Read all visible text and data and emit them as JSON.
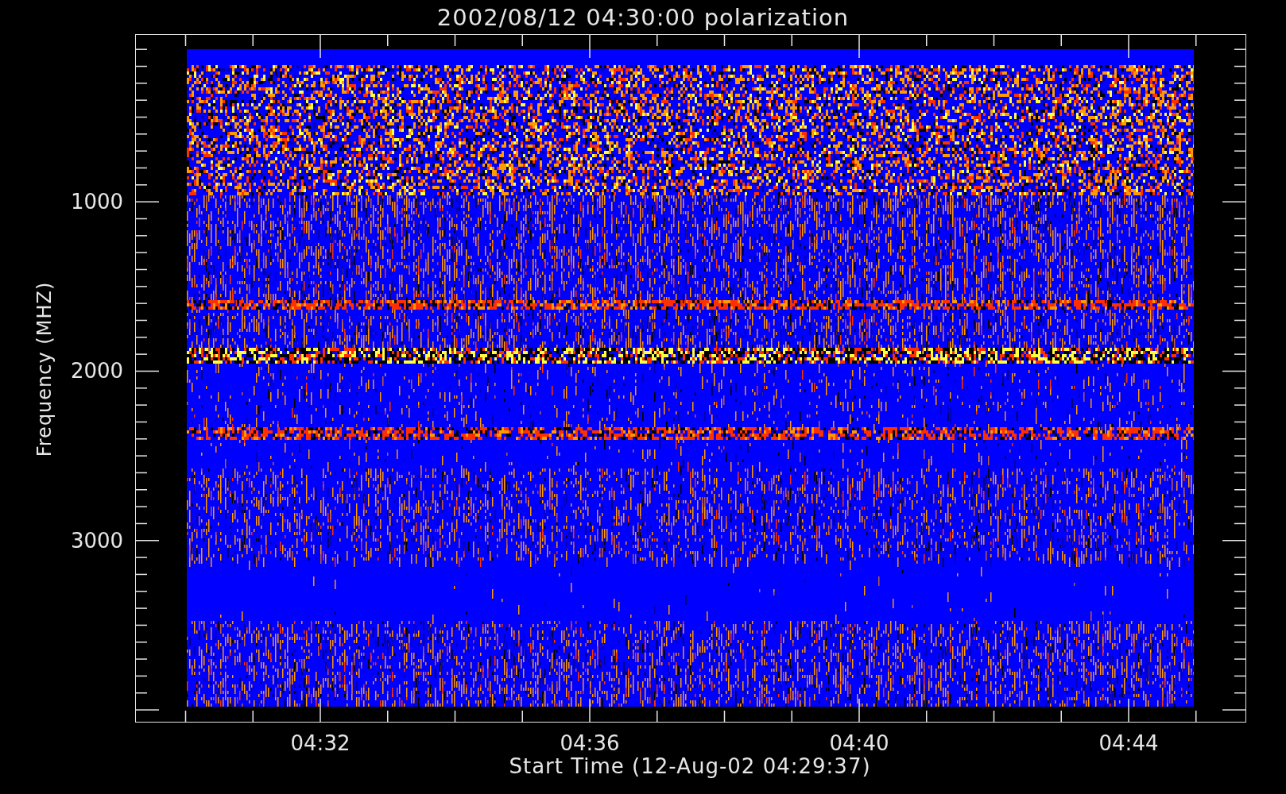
{
  "title": "2002/08/12 04:30:00 polarization",
  "y_axis": {
    "label": "Frequency (MHZ)",
    "ticks": [
      "1000",
      "2000",
      "3000"
    ]
  },
  "x_axis": {
    "label": "Start Time (12-Aug-02 04:29:37)",
    "ticks": [
      "04:32",
      "04:36",
      "04:40",
      "04:44"
    ]
  }
}
